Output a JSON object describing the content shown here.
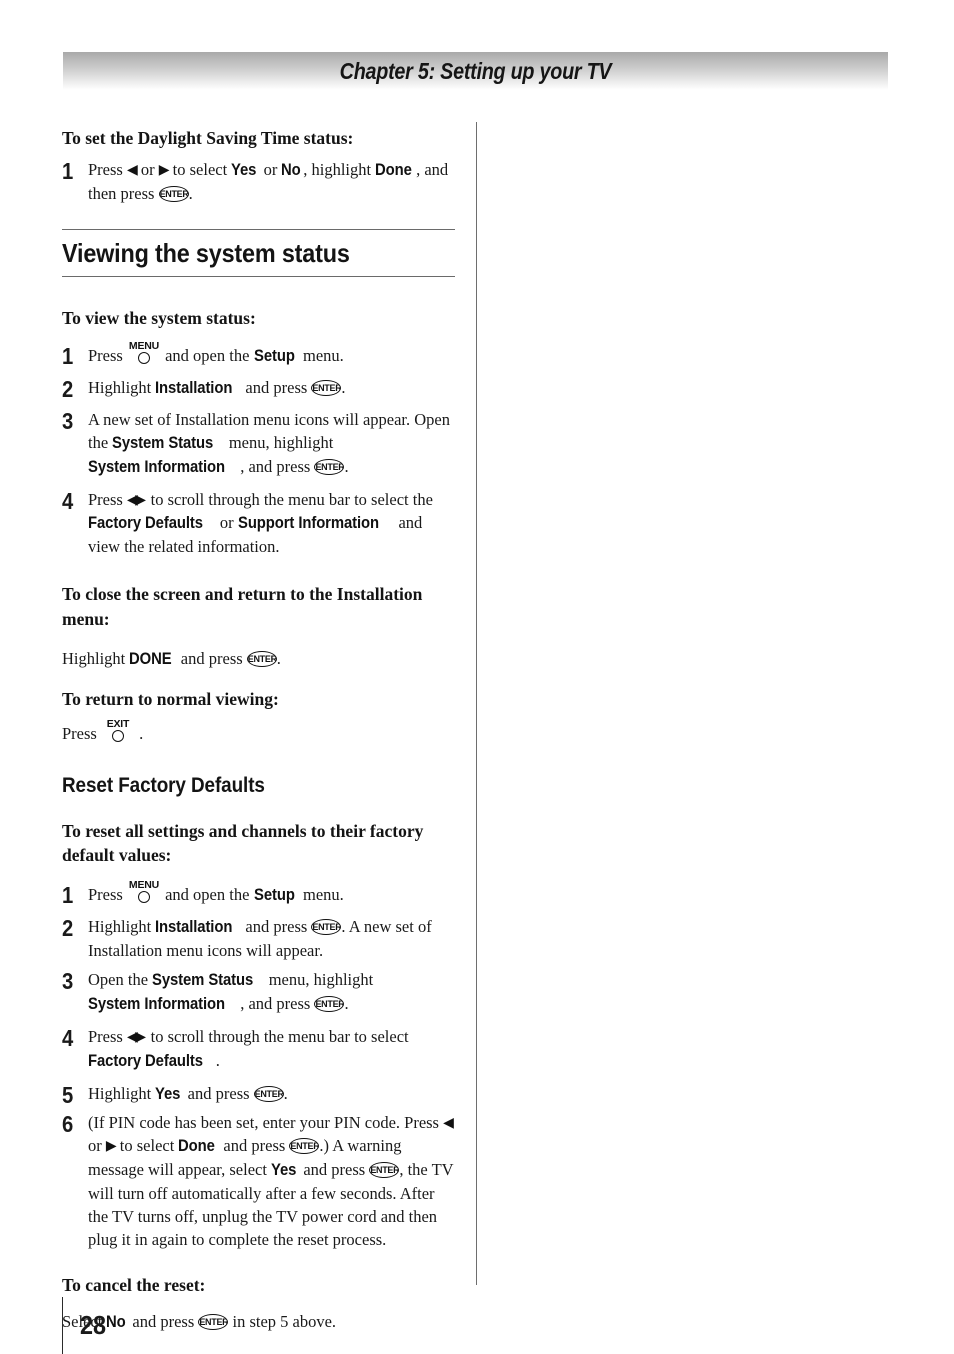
{
  "chapter": {
    "title": "Chapter 5: Setting up your TV"
  },
  "page": {
    "number": "28"
  },
  "icons": {
    "enter": "ENTER",
    "menu": "MENU",
    "exit": "EXIT",
    "arrow_left": "◀",
    "arrow_right": "▶",
    "arrow_pair": "◀▶"
  },
  "sections": {
    "dst": {
      "heading": "To set the Daylight Saving Time status:",
      "step1": {
        "num": "1",
        "t1": "Press ",
        "t2": " or ",
        "t3": " to select ",
        "ui_yes": "Yes",
        "t4": " or ",
        "ui_no": "No",
        "t5": ", highlight ",
        "ui_done": "Done",
        "t6": ", and then press ",
        "t7": "."
      }
    },
    "viewing_status": {
      "heading": "Viewing the system status",
      "task1": "To view the system status:",
      "steps": {
        "s1": {
          "num": "1",
          "t1": "Press ",
          "t2": " and open the ",
          "ui_setup": "Setup",
          "t3": " menu."
        },
        "s2": {
          "num": "2",
          "t1": "Highlight ",
          "ui_installation": "Installation",
          "t2": " and press ",
          "t3": "."
        },
        "s3": {
          "num": "3",
          "t1": "A new set of Installation menu icons will appear. Open the ",
          "ui_system_status": "System Status",
          "t2": " menu, highlight ",
          "ui_system_information": "System Information",
          "t3": ", and press ",
          "t4": "."
        },
        "s4": {
          "num": "4",
          "t1": "Press ",
          "t2": " to scroll through the menu bar to select the ",
          "ui_factory_defaults": "Factory Defaults",
          "t3": " or ",
          "ui_support_information": "Support Information",
          "t4": " and view the related information."
        }
      },
      "task2": "To close the screen and return to the Installation menu:",
      "task2_body": {
        "t1": "Highlight ",
        "ui_done": "DONE",
        "t2": " and press ",
        "t3": "."
      },
      "task3": "To return to normal viewing:",
      "task3_body": {
        "t1": "Press ",
        "t2": " ."
      }
    },
    "reset_factory": {
      "heading": "Reset Factory Defaults",
      "task1": "To reset all settings and channels to their factory default values:",
      "steps": {
        "s1": {
          "num": "1",
          "t1": "Press ",
          "t2": " and open the ",
          "ui_setup": "Setup",
          "t3": " menu."
        },
        "s2": {
          "num": "2",
          "t1": "Highlight ",
          "ui_installation": "Installation",
          "t2": " and press ",
          "t3": ". A new set of Installation menu icons will appear."
        },
        "s3": {
          "num": "3",
          "t1": "Open the ",
          "ui_system_status": "System Status",
          "t2": " menu, highlight ",
          "ui_system_information": "System Information",
          "t3": ", and press ",
          "t4": "."
        },
        "s4": {
          "num": "4",
          "t1": "Press ",
          "t2": " to scroll through the menu bar to select ",
          "ui_factory_defaults": "Factory Defaults",
          "t3": "."
        },
        "s5": {
          "num": "5",
          "t1": "Highlight ",
          "ui_yes": "Yes",
          "t2": " and press ",
          "t3": "."
        },
        "s6": {
          "num": "6",
          "t1": "(If PIN code has been set, enter your PIN code. Press ",
          "t2": " or ",
          "t3": " to select ",
          "ui_done": "Done",
          "t4": " and press ",
          "t5": ".) A warning message will appear, select ",
          "ui_yes": "Yes",
          "t6": " and press ",
          "t7": ", the TV will turn off automatically after a few seconds. After the TV turns off, unplug the TV power cord and then plug it in again to complete the reset process."
        }
      },
      "task2": "To cancel the reset:",
      "task2_body": {
        "t1": "Select ",
        "ui_no": "No",
        "t2": " and press ",
        "t3": " in step 5 above."
      }
    }
  }
}
